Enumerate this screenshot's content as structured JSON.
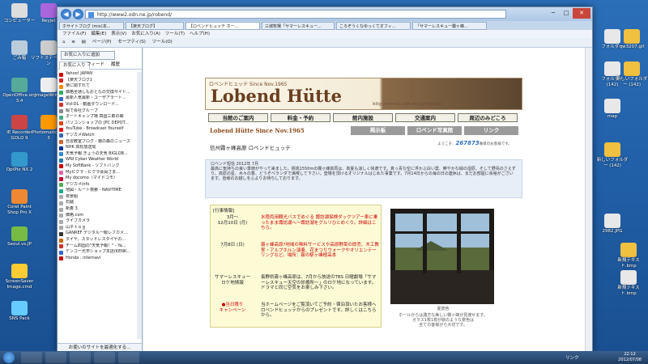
{
  "desktop": {
    "left_icons": [
      "コンピューター",
      "ごみ箱",
      "OpenOffice.org 3.4",
      "IE Recorder GOLD 9",
      "OptPix NX 2",
      "Corel Paint Shop Pro X",
      "Seoul.vs.JP",
      "ScreenSaver Image.cmd",
      "SNS Pack",
      "Reyjet",
      "ソフトステーション",
      "ImageWriter",
      "Photomatic Pro 3"
    ],
    "right_icons": [
      "フォルダー",
      "qw3207.gif",
      "フォルダー (142)",
      "新しいフォルダー (142)",
      "map",
      "新しいフォルダー (142)",
      "2982.JPG",
      "新規テキスト.bmp",
      "新規テキスト.bmp"
    ],
    "notice": "新着"
  },
  "browser": {
    "url": "http://www2.odn.ne.jp/robend/",
    "tabs": [
      "ホサイトブログ (mix)本...",
      "【楽天ブログ】",
      "【ロベンドヒュッテ ホー...",
      "三城牧場「サマーレスキュー...",
      "ころぞうくなゆっくてオフィ...",
      "「サマーレスキュー霧ヶ峰..."
    ],
    "menu": [
      "ファイル(F)",
      "編集(E)",
      "表示(V)",
      "お気に入り(A)",
      "ツール(T)",
      "ヘルプ(H)"
    ],
    "toolbar": [
      "ページ(P)",
      "セーフティ(S)",
      "ツール(O)"
    ]
  },
  "favorites": {
    "add_button": "お気に入りに追加",
    "tabs": [
      "お気に入り",
      "フィード",
      "履歴"
    ],
    "items": [
      "Yahoo! JAPAN",
      "【楽天ブログ】",
      "楽に関すれて",
      "価格全通しもおとなの交換サイト...",
      "最新人気最新・ユーザアラート...",
      "Vid-DL - 動画ダウンロード...",
      "暇で会社グループ",
      "オートキャンプ場 四国三郎の郷",
      "パソコンショップの [PC DEPOT...",
      "YouTube - Broadcast Yourself",
      "デジカメWatch",
      "自習教室ブログ - 霧の森のニュース",
      "NHK 高松放送局",
      "天気予報 きょうの天気 BIGLOB...",
      "WNI Cyber Weather World",
      "My SoftBank - ソフトバンク",
      "Myピクラ - ピクラ会員さま...",
      "My docomo（マイドコモ）",
      "デジカメinfo",
      "地図・ルート検索 - NAVITIME",
      "夜景組",
      "石鎚",
      "新着 3",
      "価格.com",
      "ライブカメラ",
      "山ネｔｏｇ",
      "GANREF デジタル一眼レフカメ...",
      "タイヤ、スタッドレスタイヤの...",
      "チーム四国の\"天気予報！\" - Ya...",
      "ケンコー光学ショップ本店(KENK...",
      "Honda : internavi"
    ],
    "footer": "お使いのサイトを最適化する..."
  },
  "site": {
    "banner_small": "ロベンドヒュッテ  Since Nov.1965",
    "banner_title": "Lobend Hütte",
    "banner_url": "http://www2.odn.ne.jp/robend/",
    "nav1": [
      "当館のご案内",
      "料金・予約",
      "館内施設",
      "交通案内",
      "周辺のみどころ"
    ],
    "sub_title": "Lobend Hütte  Since Nov.1965",
    "nav2": [
      "掲示板",
      "ロベンド写真館",
      "リンク"
    ],
    "location": "信州霧ヶ峰高原  ロベンドヒュッテ",
    "counter_prefix": "ようこそ：",
    "counter_value": "267873",
    "counter_suffix": "番目のお客様です。",
    "news": "ロベンド短信  2012年 7月\n最高に気持ちの良い季節がやって来ました。標高1550mの霧ヶ峰高原は、真夏も涼しく快適です。真っ青な空に浮かぶ白い雲、鮮やかな緑の湿原、そして野鳥のさえずり。高原の星、木々の香、どうぞベランダで満喫して下さい。登場を頂けるオリジナルはじめた事業です。7月14日からの海の日の連休は、まだお部屋に余裕がございます。皆様のお越しを心よりお待ちしております。",
    "events_head": "[行事情報]",
    "events": [
      {
        "date": "3月〜\n12月10日 (月)",
        "text": "水陸両用観光バスでめぐる  諏訪湖探検ダックツアー車に乗ったまま諏訪湖へ〜諏訪湖をグルリひとめぐり。詳細はこちら。"
      },
      {
        "date": "7月8日 (日)",
        "text": "霧ヶ峰高原?地域の無料サービスや高原野菜の即売、木工教室・アルプホルン演奏、花まつりウォークやオリエンテーリングなど。場所：霧の駅ヶ峰極高本"
      },
      {
        "date": "サマーレスキュー\nロケ地情報",
        "text": "長野県霧ヶ峰高原は、7月から放送のTBS 日曜劇場「サマーレスキュー天空の診療所〜」のロケ地になっています。ドラマと同じ空気をお楽しみ下さい。"
      },
      {
        "date": "●当日限り\nキャンペーン",
        "text": "当ホームページをご覧頂いてご予約・宿泊頂いたお客様へロベンドヒュッテからのプレゼントです。詳しくはこちらから。"
      }
    ],
    "photo_caption_title": "夏景色",
    "photo_caption": "ホールからは諏方な美しい霧ヶ峰が見渡せます。\nガラス1枚1枚が絵のような景色は\n全ての客様がら大切です。"
  },
  "taskbar": {
    "time": "22:12",
    "date": "2012/07/08",
    "lang": "リンク"
  }
}
